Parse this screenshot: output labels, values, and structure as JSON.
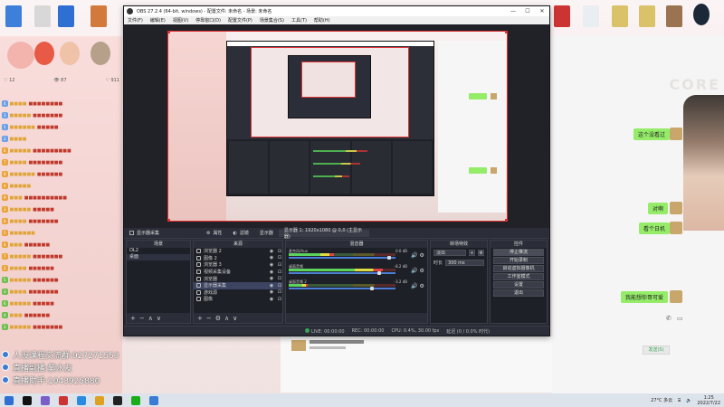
{
  "obs": {
    "title": "OBS 27.2.4 (64-bit, windows) - 配置文件: 未命名 - 场景: 未命名",
    "menu": [
      "文件(F)",
      "编辑(E)",
      "视图(V)",
      "停靠窗口(D)",
      "配置文件(P)",
      "场景集合(S)",
      "工具(T)",
      "帮助(H)"
    ],
    "window_buttons": [
      "—",
      "☐",
      "✕"
    ],
    "dock_header": {
      "source_label": "显示器采集",
      "props_label": "属性",
      "filters_label": "滤镜",
      "display_label": "显示器",
      "display_value": "显示器 1: 1920x1080 @ 0,0 (主显示器)"
    },
    "scenes": {
      "title": "场景",
      "items": [
        "OL2",
        "桌面"
      ],
      "selected_index": 1
    },
    "sources": {
      "title": "来源",
      "items": [
        {
          "name": "浏览器 2"
        },
        {
          "name": "图像 2"
        },
        {
          "name": "浏览器 3"
        },
        {
          "name": "视频采集设备"
        },
        {
          "name": "浏览器"
        },
        {
          "name": "显示器采集"
        },
        {
          "name": "游戏源"
        },
        {
          "name": "图像"
        }
      ],
      "selected_index": 5
    },
    "mixer": {
      "title": "混音器",
      "channels": [
        {
          "name": "麦克风/Aux",
          "db": "0.0 dB",
          "level": 0.42,
          "knob": 0.96
        },
        {
          "name": "桌面音频",
          "db": "-8.2 dB",
          "level": 0.88,
          "knob": 0.86
        },
        {
          "name": "桌面音频 2",
          "db": "-3.2 dB",
          "level": 0.18,
          "knob": 0.79
        }
      ]
    },
    "transitions": {
      "title": "转场特效",
      "type": "淡出",
      "duration_label": "时长",
      "duration": "300 ms"
    },
    "controls": {
      "title": "控件",
      "buttons": [
        "停止推流",
        "开始录制",
        "启动虚拟摄像机",
        "工作室模式",
        "设置",
        "退出"
      ]
    },
    "status": {
      "live_label": "LIVE: 00:00:00",
      "rec_label": "REC: 00:00:00",
      "cpu": "CPU: 0.4%, 30.00 fps",
      "dropped": "延迟 (0 / 0.0% 时代)"
    },
    "footer_buttons": [
      "+",
      "−",
      "∧",
      "∨"
    ]
  },
  "live": {
    "stats": [
      "♡ 12",
      "👁 87",
      "♡ 911"
    ],
    "info": [
      "人设课程交流群:927271553",
      "直播副播:紫水友",
      "直播助手:1043925880"
    ]
  },
  "chat": {
    "bubbles": [
      "这个没看过",
      "对啊",
      "看个日机",
      "我能想你哥可爱"
    ],
    "input_placeholder": "发送(S)"
  },
  "core_logo": "CORE",
  "taskbar": {
    "weather": "27°C 多云",
    "time": "1:25",
    "date": "2022/7/22"
  }
}
